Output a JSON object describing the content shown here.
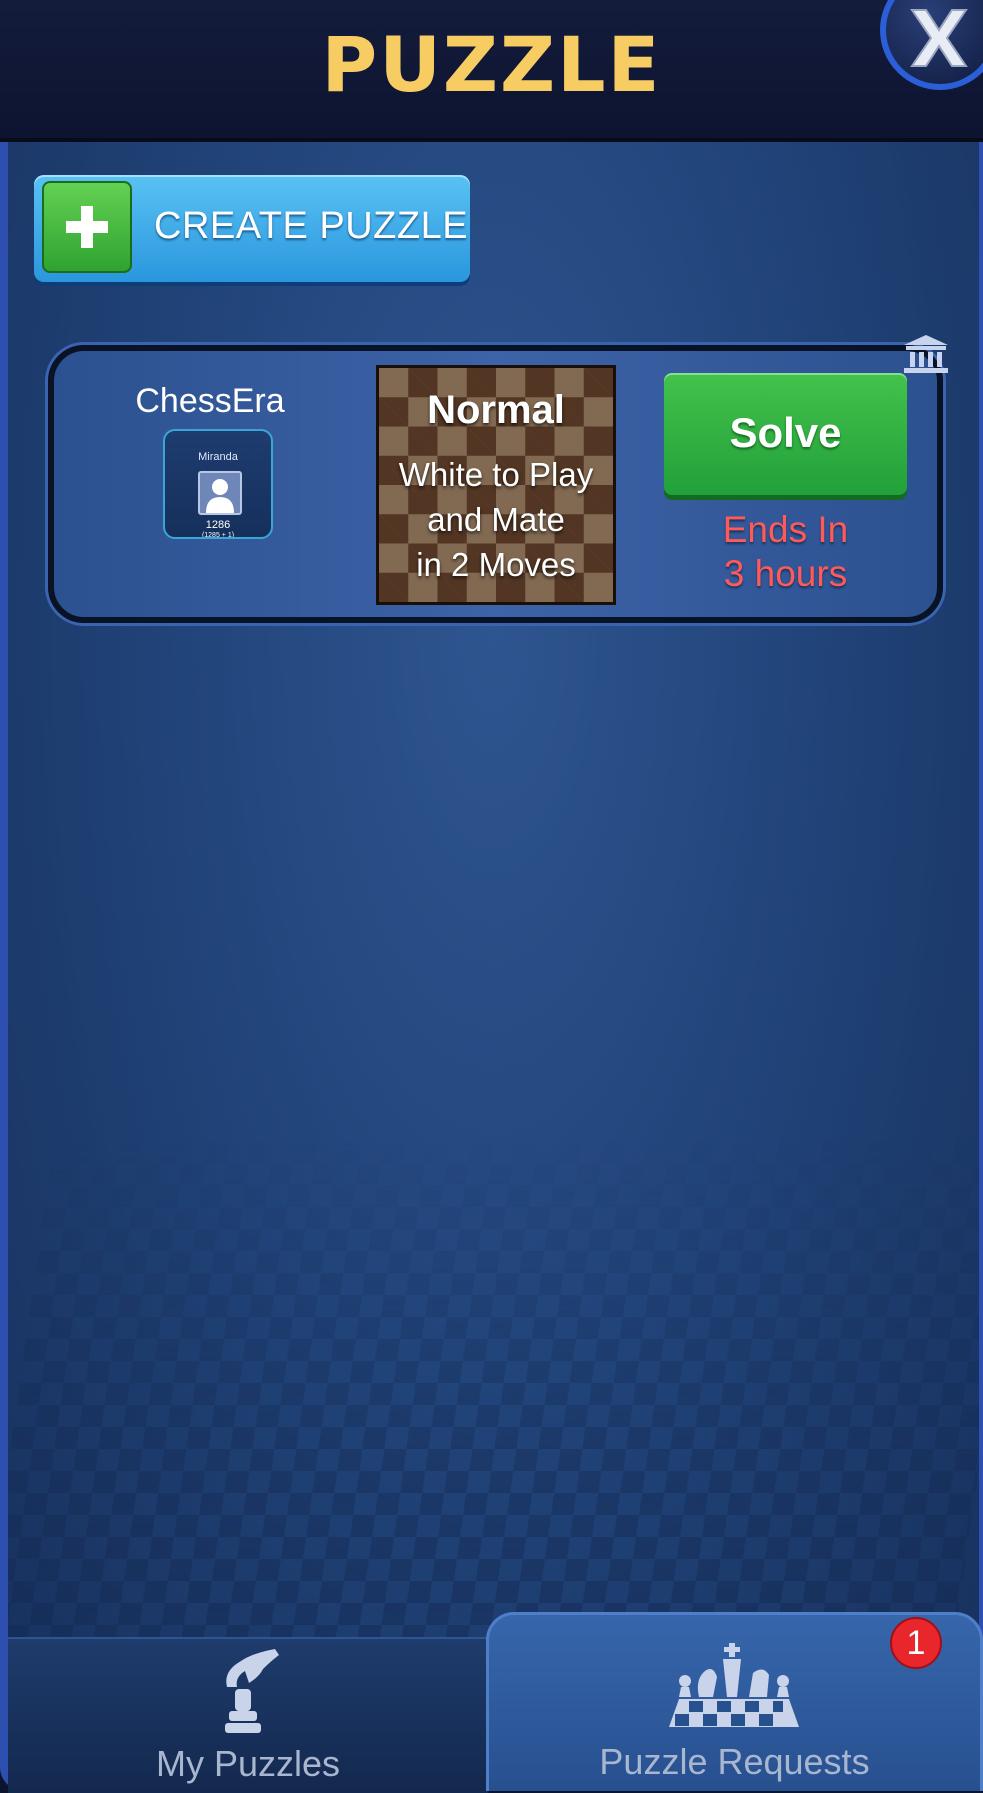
{
  "header": {
    "title": "PUZZLE",
    "close_icon": "close-x-icon"
  },
  "toolbar": {
    "create_label": "CREATE PUZZLE",
    "create_icon": "plus-icon"
  },
  "puzzle_card": {
    "opponent_name": "ChessEra",
    "avatar": {
      "name": "Miranda",
      "rating": "1286",
      "rating_detail": "(1285 + 1)"
    },
    "mode": "Normal",
    "description_lines": [
      "White to Play",
      "and Mate",
      "in 2 Moves"
    ],
    "solve_label": "Solve",
    "ends_line1": "Ends In",
    "ends_line2": "3 hours",
    "corner_icon": "bank-icon"
  },
  "tabs": {
    "my_puzzles": {
      "label": "My Puzzles",
      "icon": "knight-hand-icon"
    },
    "requests": {
      "label": "Puzzle Requests",
      "icon": "chess-pieces-icon",
      "badge": "1"
    }
  },
  "colors": {
    "title": "#f7cc63",
    "solve": "#2fb043",
    "create": "#3aa6e8",
    "ends": "#ff5a5a",
    "badge": "#e8262c"
  }
}
